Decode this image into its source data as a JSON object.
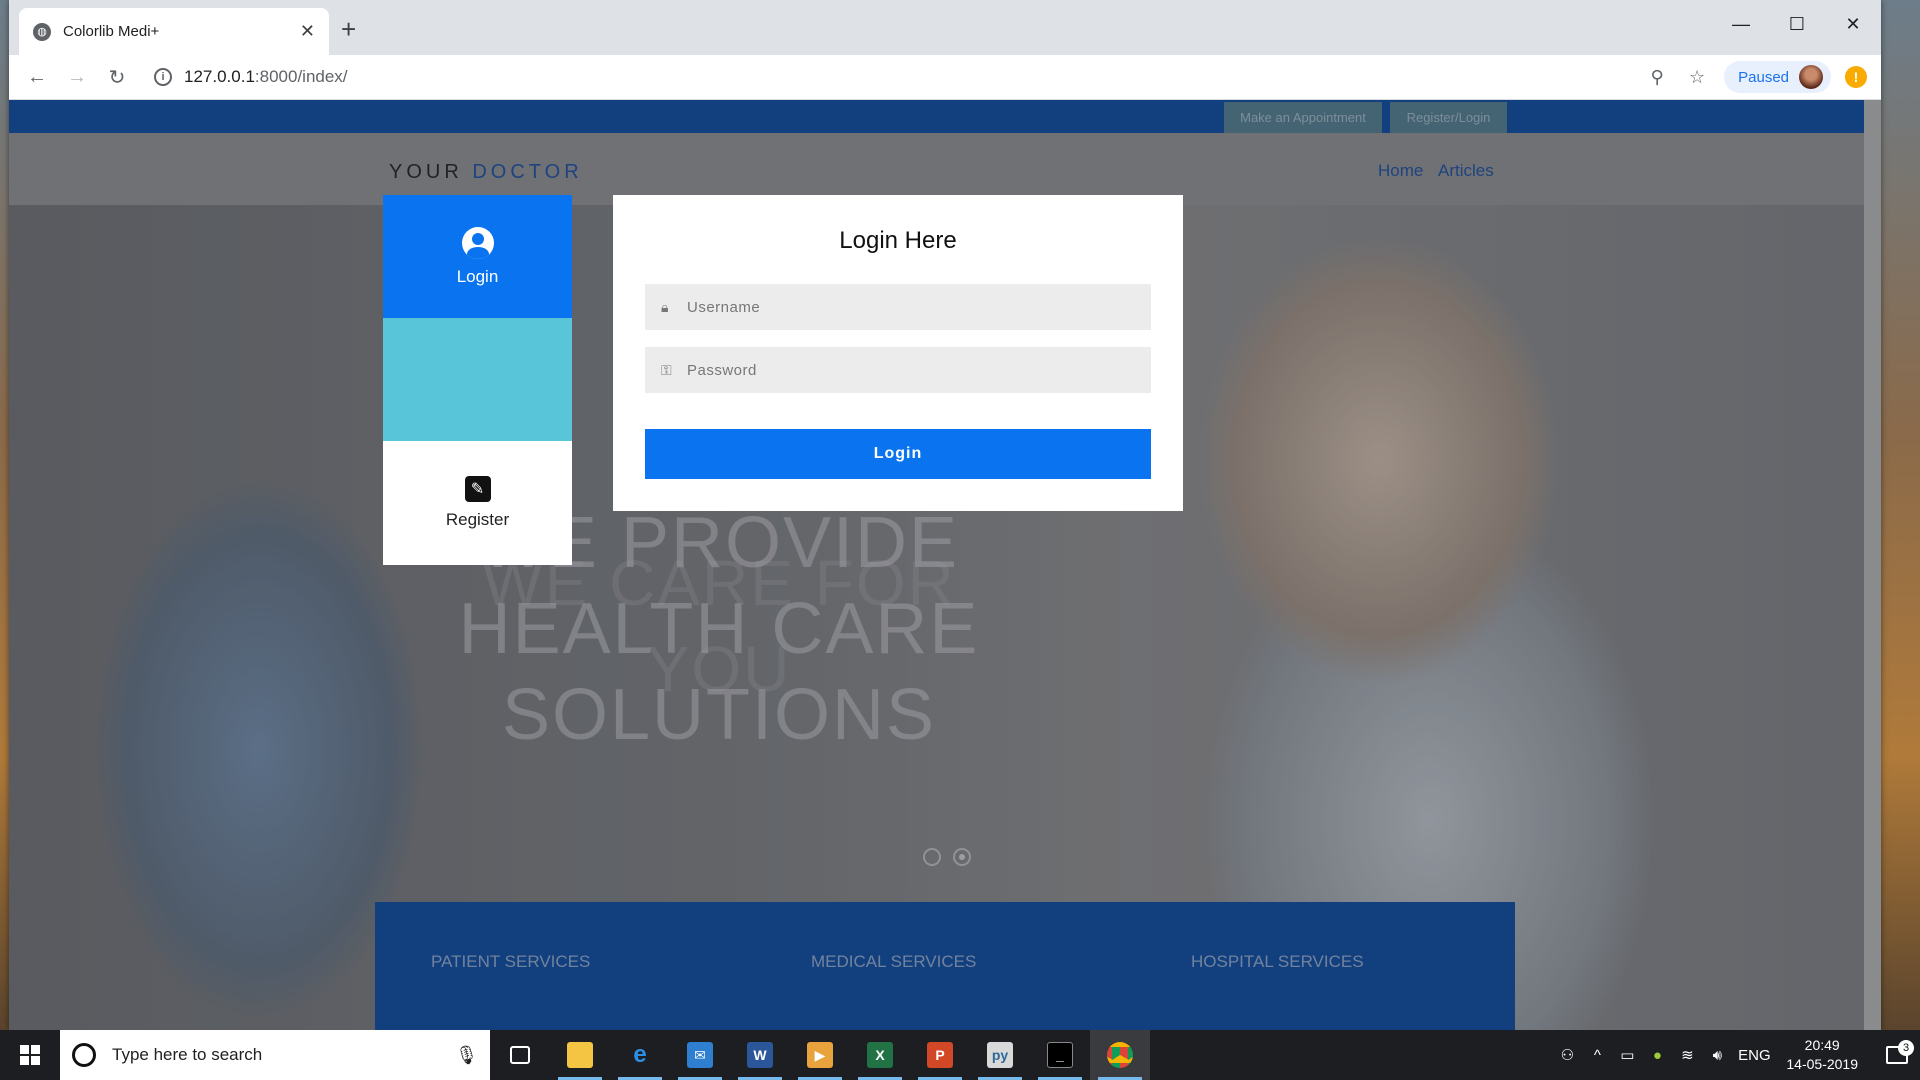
{
  "browser": {
    "tab_title": "Colorlib Medi+",
    "new_tab_glyph": "+",
    "url_host": "127.0.0.1",
    "url_path": ":8000/index/",
    "profile_status": "Paused",
    "window_controls": {
      "minimize": "—",
      "maximize": "☐",
      "close": "✕"
    }
  },
  "site": {
    "topbar": {
      "appointment": "Make an Appointment",
      "register_login": "Register/Login"
    },
    "brand": {
      "part1": "YOUR",
      "part2": "DOCTOR"
    },
    "nav": {
      "home": "Home",
      "articles": "Articles"
    },
    "hero": {
      "line1": "WE PROVIDE",
      "line2": "HEALTH CARE",
      "line3": "SOLUTIONS",
      "ghost1": "WE CARE FOR",
      "ghost2": "YOU"
    },
    "services": {
      "patient": "PATIENT SERVICES",
      "medical": "MEDICAL SERVICES",
      "hospital": "HOSPITAL SERVICES"
    }
  },
  "modal": {
    "side_login_label": "Login",
    "side_register_label": "Register",
    "title": "Login Here",
    "username_placeholder": "Username",
    "password_placeholder": "Password",
    "submit_label": "Login"
  },
  "taskbar": {
    "search_placeholder": "Type here to search",
    "language": "ENG",
    "time": "20:49",
    "date": "14-05-2019",
    "notification_count": "3"
  },
  "colors": {
    "site_blue": "#0a4a9e",
    "login_blue": "#0a74f0",
    "teal": "#58c6d8"
  }
}
